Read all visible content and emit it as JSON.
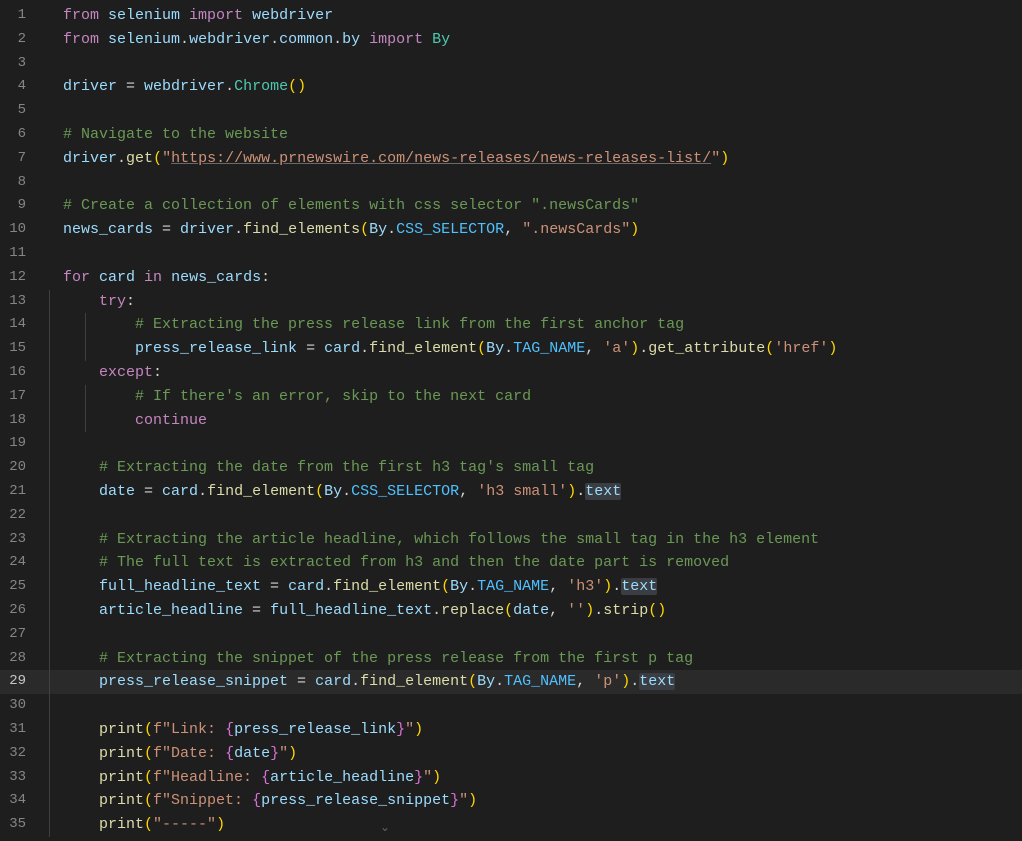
{
  "editor": {
    "active_line": 29,
    "lines": [
      {
        "n": 1,
        "indent": 0,
        "guides": [],
        "tokens": [
          {
            "t": "from ",
            "c": "keyword"
          },
          {
            "t": "selenium ",
            "c": "var"
          },
          {
            "t": "import ",
            "c": "keyword"
          },
          {
            "t": "webdriver",
            "c": "var"
          }
        ]
      },
      {
        "n": 2,
        "indent": 0,
        "guides": [],
        "tokens": [
          {
            "t": "from ",
            "c": "keyword"
          },
          {
            "t": "selenium",
            "c": "var"
          },
          {
            "t": ".",
            "c": "punct"
          },
          {
            "t": "webdriver",
            "c": "var"
          },
          {
            "t": ".",
            "c": "punct"
          },
          {
            "t": "common",
            "c": "var"
          },
          {
            "t": ".",
            "c": "punct"
          },
          {
            "t": "by ",
            "c": "var"
          },
          {
            "t": "import ",
            "c": "keyword"
          },
          {
            "t": "By",
            "c": "builtin"
          }
        ]
      },
      {
        "n": 3,
        "indent": 0,
        "guides": [],
        "tokens": []
      },
      {
        "n": 4,
        "indent": 0,
        "guides": [],
        "tokens": [
          {
            "t": "driver",
            "c": "var"
          },
          {
            "t": " = ",
            "c": "punct"
          },
          {
            "t": "webdriver",
            "c": "var"
          },
          {
            "t": ".",
            "c": "punct"
          },
          {
            "t": "Chrome",
            "c": "builtin"
          },
          {
            "t": "(",
            "c": "punct-yel"
          },
          {
            "t": ")",
            "c": "punct-yel"
          }
        ]
      },
      {
        "n": 5,
        "indent": 0,
        "guides": [],
        "tokens": []
      },
      {
        "n": 6,
        "indent": 0,
        "guides": [],
        "tokens": [
          {
            "t": "# Navigate to the website",
            "c": "comment"
          }
        ]
      },
      {
        "n": 7,
        "indent": 0,
        "guides": [],
        "tokens": [
          {
            "t": "driver",
            "c": "var"
          },
          {
            "t": ".",
            "c": "punct"
          },
          {
            "t": "get",
            "c": "func"
          },
          {
            "t": "(",
            "c": "punct-yel"
          },
          {
            "t": "\"",
            "c": "string"
          },
          {
            "t": "https://www.prnewswire.com/news-releases/news-releases-list/",
            "c": "url"
          },
          {
            "t": "\"",
            "c": "string"
          },
          {
            "t": ")",
            "c": "punct-yel"
          }
        ]
      },
      {
        "n": 8,
        "indent": 0,
        "guides": [],
        "tokens": []
      },
      {
        "n": 9,
        "indent": 0,
        "guides": [],
        "tokens": [
          {
            "t": "# Create a collection of elements with css selector \".newsCards\"",
            "c": "comment"
          }
        ]
      },
      {
        "n": 10,
        "indent": 0,
        "guides": [],
        "tokens": [
          {
            "t": "news_cards",
            "c": "var"
          },
          {
            "t": " = ",
            "c": "punct"
          },
          {
            "t": "driver",
            "c": "var"
          },
          {
            "t": ".",
            "c": "punct"
          },
          {
            "t": "find_elements",
            "c": "func"
          },
          {
            "t": "(",
            "c": "punct-yel"
          },
          {
            "t": "By",
            "c": "var"
          },
          {
            "t": ".",
            "c": "punct"
          },
          {
            "t": "CSS_SELECTOR",
            "c": "const"
          },
          {
            "t": ", ",
            "c": "punct"
          },
          {
            "t": "\".newsCards\"",
            "c": "string"
          },
          {
            "t": ")",
            "c": "punct-yel"
          }
        ]
      },
      {
        "n": 11,
        "indent": 0,
        "guides": [],
        "tokens": []
      },
      {
        "n": 12,
        "indent": 0,
        "guides": [],
        "tokens": [
          {
            "t": "for ",
            "c": "keyword"
          },
          {
            "t": "card",
            "c": "var"
          },
          {
            "t": " in ",
            "c": "keyword"
          },
          {
            "t": "news_cards",
            "c": "var"
          },
          {
            "t": ":",
            "c": "punct"
          }
        ]
      },
      {
        "n": 13,
        "indent": 1,
        "guides": [
          1
        ],
        "tokens": [
          {
            "t": "try",
            "c": "keyword"
          },
          {
            "t": ":",
            "c": "punct"
          }
        ]
      },
      {
        "n": 14,
        "indent": 2,
        "guides": [
          1,
          2
        ],
        "tokens": [
          {
            "t": "# Extracting the press release link from the first anchor tag",
            "c": "comment"
          }
        ]
      },
      {
        "n": 15,
        "indent": 2,
        "guides": [
          1,
          2
        ],
        "tokens": [
          {
            "t": "press_release_link",
            "c": "var"
          },
          {
            "t": " = ",
            "c": "punct"
          },
          {
            "t": "card",
            "c": "var"
          },
          {
            "t": ".",
            "c": "punct"
          },
          {
            "t": "find_element",
            "c": "func"
          },
          {
            "t": "(",
            "c": "punct-yel"
          },
          {
            "t": "By",
            "c": "var"
          },
          {
            "t": ".",
            "c": "punct"
          },
          {
            "t": "TAG_NAME",
            "c": "const"
          },
          {
            "t": ", ",
            "c": "punct"
          },
          {
            "t": "'a'",
            "c": "string"
          },
          {
            "t": ")",
            "c": "punct-yel"
          },
          {
            "t": ".",
            "c": "punct"
          },
          {
            "t": "get_attribute",
            "c": "func"
          },
          {
            "t": "(",
            "c": "punct-yel"
          },
          {
            "t": "'href'",
            "c": "string"
          },
          {
            "t": ")",
            "c": "punct-yel"
          }
        ]
      },
      {
        "n": 16,
        "indent": 1,
        "guides": [
          1
        ],
        "tokens": [
          {
            "t": "except",
            "c": "keyword"
          },
          {
            "t": ":",
            "c": "punct"
          }
        ]
      },
      {
        "n": 17,
        "indent": 2,
        "guides": [
          1,
          2
        ],
        "tokens": [
          {
            "t": "# If there's an error, skip to the next card",
            "c": "comment"
          }
        ]
      },
      {
        "n": 18,
        "indent": 2,
        "guides": [
          1,
          2
        ],
        "tokens": [
          {
            "t": "continue",
            "c": "keyword"
          }
        ]
      },
      {
        "n": 19,
        "indent": 0,
        "guides": [
          1
        ],
        "tokens": []
      },
      {
        "n": 20,
        "indent": 1,
        "guides": [
          1
        ],
        "tokens": [
          {
            "t": "# Extracting the date from the first h3 tag's small tag",
            "c": "comment"
          }
        ]
      },
      {
        "n": 21,
        "indent": 1,
        "guides": [
          1
        ],
        "tokens": [
          {
            "t": "date",
            "c": "var"
          },
          {
            "t": " = ",
            "c": "punct"
          },
          {
            "t": "card",
            "c": "var"
          },
          {
            "t": ".",
            "c": "punct"
          },
          {
            "t": "find_element",
            "c": "func"
          },
          {
            "t": "(",
            "c": "punct-yel"
          },
          {
            "t": "By",
            "c": "var"
          },
          {
            "t": ".",
            "c": "punct"
          },
          {
            "t": "CSS_SELECTOR",
            "c": "const"
          },
          {
            "t": ", ",
            "c": "punct"
          },
          {
            "t": "'h3 small'",
            "c": "string"
          },
          {
            "t": ")",
            "c": "punct-yel"
          },
          {
            "t": ".",
            "c": "punct"
          },
          {
            "t": "text",
            "c": "var",
            "sel": true
          }
        ]
      },
      {
        "n": 22,
        "indent": 0,
        "guides": [
          1
        ],
        "tokens": []
      },
      {
        "n": 23,
        "indent": 1,
        "guides": [
          1
        ],
        "tokens": [
          {
            "t": "# Extracting the article headline, which follows the small tag in the h3 element",
            "c": "comment"
          }
        ]
      },
      {
        "n": 24,
        "indent": 1,
        "guides": [
          1
        ],
        "tokens": [
          {
            "t": "# The full text is extracted from h3 and then the date part is removed",
            "c": "comment"
          }
        ]
      },
      {
        "n": 25,
        "indent": 1,
        "guides": [
          1
        ],
        "tokens": [
          {
            "t": "full_headline_text",
            "c": "var"
          },
          {
            "t": " = ",
            "c": "punct"
          },
          {
            "t": "card",
            "c": "var"
          },
          {
            "t": ".",
            "c": "punct"
          },
          {
            "t": "find_element",
            "c": "func"
          },
          {
            "t": "(",
            "c": "punct-yel"
          },
          {
            "t": "By",
            "c": "var"
          },
          {
            "t": ".",
            "c": "punct"
          },
          {
            "t": "TAG_NAME",
            "c": "const"
          },
          {
            "t": ", ",
            "c": "punct"
          },
          {
            "t": "'h3'",
            "c": "string"
          },
          {
            "t": ")",
            "c": "punct-yel"
          },
          {
            "t": ".",
            "c": "punct"
          },
          {
            "t": "text",
            "c": "var",
            "sel": true
          }
        ]
      },
      {
        "n": 26,
        "indent": 1,
        "guides": [
          1
        ],
        "tokens": [
          {
            "t": "article_headline",
            "c": "var"
          },
          {
            "t": " = ",
            "c": "punct"
          },
          {
            "t": "full_headline_text",
            "c": "var"
          },
          {
            "t": ".",
            "c": "punct"
          },
          {
            "t": "replace",
            "c": "func"
          },
          {
            "t": "(",
            "c": "punct-yel"
          },
          {
            "t": "date",
            "c": "var"
          },
          {
            "t": ", ",
            "c": "punct"
          },
          {
            "t": "''",
            "c": "string"
          },
          {
            "t": ")",
            "c": "punct-yel"
          },
          {
            "t": ".",
            "c": "punct"
          },
          {
            "t": "strip",
            "c": "func"
          },
          {
            "t": "(",
            "c": "punct-yel"
          },
          {
            "t": ")",
            "c": "punct-yel"
          }
        ]
      },
      {
        "n": 27,
        "indent": 0,
        "guides": [
          1
        ],
        "tokens": []
      },
      {
        "n": 28,
        "indent": 1,
        "guides": [
          1
        ],
        "tokens": [
          {
            "t": "# Extracting the snippet of the press release from the first p tag",
            "c": "comment"
          }
        ]
      },
      {
        "n": 29,
        "indent": 1,
        "guides": [
          1
        ],
        "tokens": [
          {
            "t": "press_release_snippet",
            "c": "var"
          },
          {
            "t": " = ",
            "c": "punct"
          },
          {
            "t": "card",
            "c": "var"
          },
          {
            "t": ".",
            "c": "punct"
          },
          {
            "t": "find_element",
            "c": "func"
          },
          {
            "t": "(",
            "c": "punct-yel"
          },
          {
            "t": "By",
            "c": "var"
          },
          {
            "t": ".",
            "c": "punct"
          },
          {
            "t": "TAG_NAME",
            "c": "const"
          },
          {
            "t": ", ",
            "c": "punct"
          },
          {
            "t": "'p'",
            "c": "string"
          },
          {
            "t": ")",
            "c": "punct-yel"
          },
          {
            "t": ".",
            "c": "punct"
          },
          {
            "t": "text",
            "c": "var",
            "sel": true
          }
        ]
      },
      {
        "n": 30,
        "indent": 0,
        "guides": [
          1
        ],
        "tokens": []
      },
      {
        "n": 31,
        "indent": 1,
        "guides": [
          1
        ],
        "tokens": [
          {
            "t": "print",
            "c": "func"
          },
          {
            "t": "(",
            "c": "punct-yel"
          },
          {
            "t": "f\"Link: ",
            "c": "string"
          },
          {
            "t": "{",
            "c": "punct-pur"
          },
          {
            "t": "press_release_link",
            "c": "var"
          },
          {
            "t": "}",
            "c": "punct-pur"
          },
          {
            "t": "\"",
            "c": "string"
          },
          {
            "t": ")",
            "c": "punct-yel"
          }
        ]
      },
      {
        "n": 32,
        "indent": 1,
        "guides": [
          1
        ],
        "tokens": [
          {
            "t": "print",
            "c": "func"
          },
          {
            "t": "(",
            "c": "punct-yel"
          },
          {
            "t": "f\"Date: ",
            "c": "string"
          },
          {
            "t": "{",
            "c": "punct-pur"
          },
          {
            "t": "date",
            "c": "var"
          },
          {
            "t": "}",
            "c": "punct-pur"
          },
          {
            "t": "\"",
            "c": "string"
          },
          {
            "t": ")",
            "c": "punct-yel"
          }
        ]
      },
      {
        "n": 33,
        "indent": 1,
        "guides": [
          1
        ],
        "tokens": [
          {
            "t": "print",
            "c": "func"
          },
          {
            "t": "(",
            "c": "punct-yel"
          },
          {
            "t": "f\"Headline: ",
            "c": "string"
          },
          {
            "t": "{",
            "c": "punct-pur"
          },
          {
            "t": "article_headline",
            "c": "var"
          },
          {
            "t": "}",
            "c": "punct-pur"
          },
          {
            "t": "\"",
            "c": "string"
          },
          {
            "t": ")",
            "c": "punct-yel"
          }
        ]
      },
      {
        "n": 34,
        "indent": 1,
        "guides": [
          1
        ],
        "tokens": [
          {
            "t": "print",
            "c": "func"
          },
          {
            "t": "(",
            "c": "punct-yel"
          },
          {
            "t": "f\"Snippet: ",
            "c": "string"
          },
          {
            "t": "{",
            "c": "punct-pur"
          },
          {
            "t": "press_release_snippet",
            "c": "var"
          },
          {
            "t": "}",
            "c": "punct-pur"
          },
          {
            "t": "\"",
            "c": "string"
          },
          {
            "t": ")",
            "c": "punct-yel"
          }
        ]
      },
      {
        "n": 35,
        "indent": 1,
        "guides": [
          1
        ],
        "tokens": [
          {
            "t": "print",
            "c": "func"
          },
          {
            "t": "(",
            "c": "punct-yel"
          },
          {
            "t": "\"-----\"",
            "c": "string"
          },
          {
            "t": ")",
            "c": "punct-yel"
          }
        ]
      }
    ]
  }
}
